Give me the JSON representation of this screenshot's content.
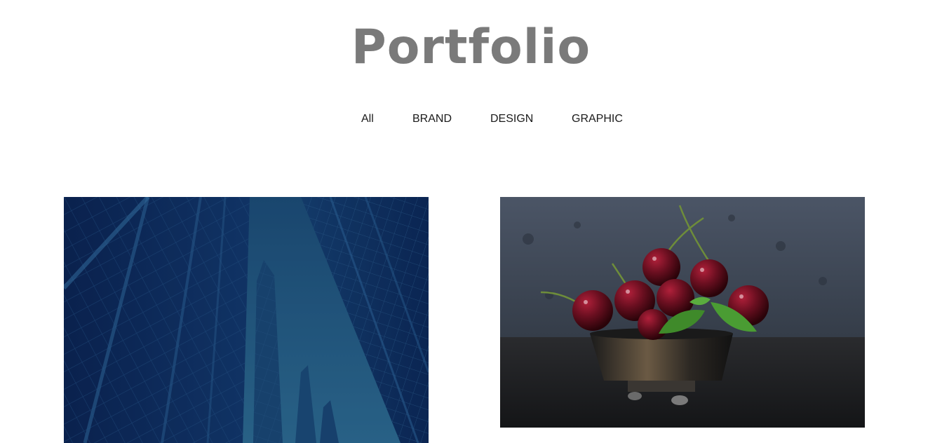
{
  "header": {
    "title": "Portfolio"
  },
  "filters": [
    {
      "label": "All",
      "active": true
    },
    {
      "label": "BRAND"
    },
    {
      "label": "DESIGN"
    },
    {
      "label": "GRAPHIC"
    }
  ],
  "colors": {
    "title": "#7a7a7a",
    "filter_text": "#1a1a1a",
    "background": "#ffffff"
  },
  "gallery": [
    {
      "image": "city-skyscrapers-photo"
    },
    {
      "image": "cherries-in-bowl-photo"
    }
  ]
}
